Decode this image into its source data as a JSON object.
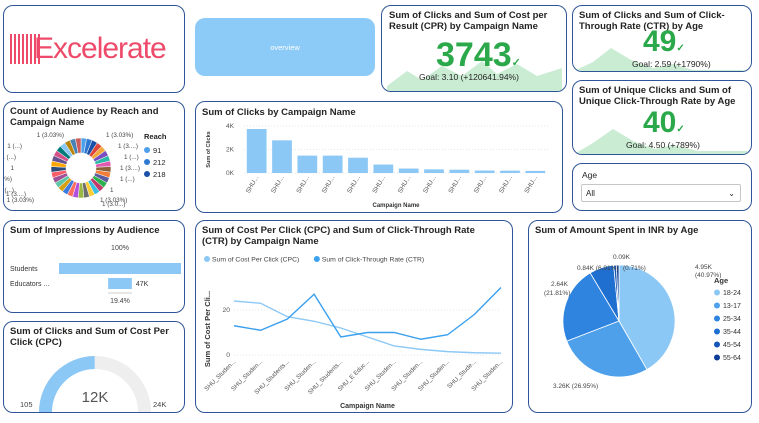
{
  "logo": {
    "text": "Excelerate"
  },
  "overview_button": {
    "label": "overview"
  },
  "kpi_clicks_cpr": {
    "title": "Sum of Clicks and Sum of Cost per Result (CPR) by Campaign Name",
    "value": "3743",
    "goal": "Goal: 3.10 (+120641.94%)"
  },
  "kpi_clicks_ctr_age": {
    "title": "Sum of Clicks and Sum of Click-Through Rate (CTR) by Age",
    "value": "49",
    "goal": "Goal: 2.59 (+1790%)"
  },
  "kpi_unique_clicks": {
    "title": "Sum of Unique Clicks and Sum of Unique Click-Through Rate by Age",
    "value": "40",
    "goal": "Goal: 4.50 (+789%)"
  },
  "age_slicer": {
    "label": "Age",
    "selected": "All"
  },
  "donut": {
    "title": "Count of Audience by Reach and Campaign Name",
    "legend_title": "Reach",
    "legend": [
      {
        "label": "91",
        "color": "#4ea0ea"
      },
      {
        "label": "212",
        "color": "#2f78d2"
      },
      {
        "label": "218",
        "color": "#1a50a8"
      }
    ],
    "labels": [
      "1 (3.03%)",
      "1 (3.03%)",
      "1 (...)",
      "1 (3....)",
      "1 (...)",
      "1 (...)",
      "1",
      "1 (3....)",
      "1 (3.03%)",
      "1 (...)",
      "1 (...)",
      "1",
      "1 (3.03%)",
      "1 (3.03%)",
      "1 (3....)",
      "1 (3.0...)"
    ]
  },
  "impressions": {
    "title": "Sum of Impressions by Audience",
    "top_label": "100%",
    "bottom_label": "19.4%",
    "chart_data": {
      "type": "bar",
      "categories": [
        "Students",
        "Educators ..."
      ],
      "values": [
        242,
        47
      ],
      "value_labels": [
        "",
        "47K"
      ]
    }
  },
  "gauge": {
    "title": "Sum of Clicks and Sum of Cost Per Click (CPC)",
    "value_label": "12K",
    "min_label": "105",
    "max_label": "24K",
    "chart_data": {
      "type": "gauge",
      "value": 12000,
      "min": 105,
      "max": 24000
    }
  },
  "clicks_bar": {
    "title": "Sum of Clicks by Campaign Name",
    "chart_data": {
      "type": "bar",
      "xlabel": "Campaign Name",
      "ylabel": "Sum of Clicks",
      "ylim": [
        0,
        4000
      ],
      "yticks": [
        "0K",
        "2K",
        "4K"
      ],
      "categories": [
        "SHU...",
        "SHU...",
        "SHU...",
        "SHU...",
        "SHU...",
        "SHU...",
        "SHU...",
        "SHU...",
        "SHU...",
        "SHU...",
        "SHU...",
        "SHU..."
      ],
      "values": [
        3743,
        2780,
        1480,
        1480,
        1300,
        720,
        380,
        310,
        280,
        210,
        200,
        180
      ]
    }
  },
  "cpc_ctr_line": {
    "title": "Sum of Cost Per Click (CPC) and Sum of Click-Through Rate (CTR) by Campaign Name",
    "chart_data": {
      "type": "line",
      "xlabel": "Campaign Name",
      "ylabel": "Sum of Cost Per Cli...",
      "ylim": [
        0,
        32
      ],
      "yticks": [
        "0",
        "20"
      ],
      "categories": [
        "SHU_Studen...",
        "SHU_Studen...",
        "SHU_Students...",
        "SHU_Studen...",
        "SHU_Students...",
        "SHU_E Educ...",
        "SHU_Studen...",
        "SHU_Studen...",
        "SHU_Studen...",
        "SHU_Stude...",
        "SHU_Studen..."
      ],
      "series": [
        {
          "name": "Sum of Cost Per Click (CPC)",
          "color": "#8cc8f5",
          "values": [
            24,
            23,
            17,
            15,
            12,
            8,
            4,
            2.5,
            1.5,
            1,
            0.8
          ]
        },
        {
          "name": "Sum of Click-Through Rate (CTR)",
          "color": "#3ba0ee",
          "values": [
            13,
            11,
            16,
            27,
            8,
            10,
            10,
            7,
            9,
            18,
            30
          ]
        }
      ]
    }
  },
  "pie": {
    "title": "Sum of Amount Spent in INR by Age",
    "legend_title": "Age",
    "chart_data": {
      "type": "pie",
      "categories": [
        "18-24",
        "13-17",
        "25-34",
        "35-44",
        "45-54",
        "55-64"
      ],
      "values": [
        4.95,
        3.26,
        2.64,
        0.84,
        0.09,
        0.09
      ],
      "labels": [
        "4.95K (40.97%)",
        "3.26K (26.95%)",
        "2.64K (21.81%)",
        "0.84K (6.91%)",
        "0.09K (0.71%)",
        "(0.71%)"
      ],
      "colors": [
        "#8cc8f5",
        "#4ea0ea",
        "#2f84e0",
        "#1f6fd0",
        "#1656b8",
        "#0d3d96"
      ]
    }
  }
}
